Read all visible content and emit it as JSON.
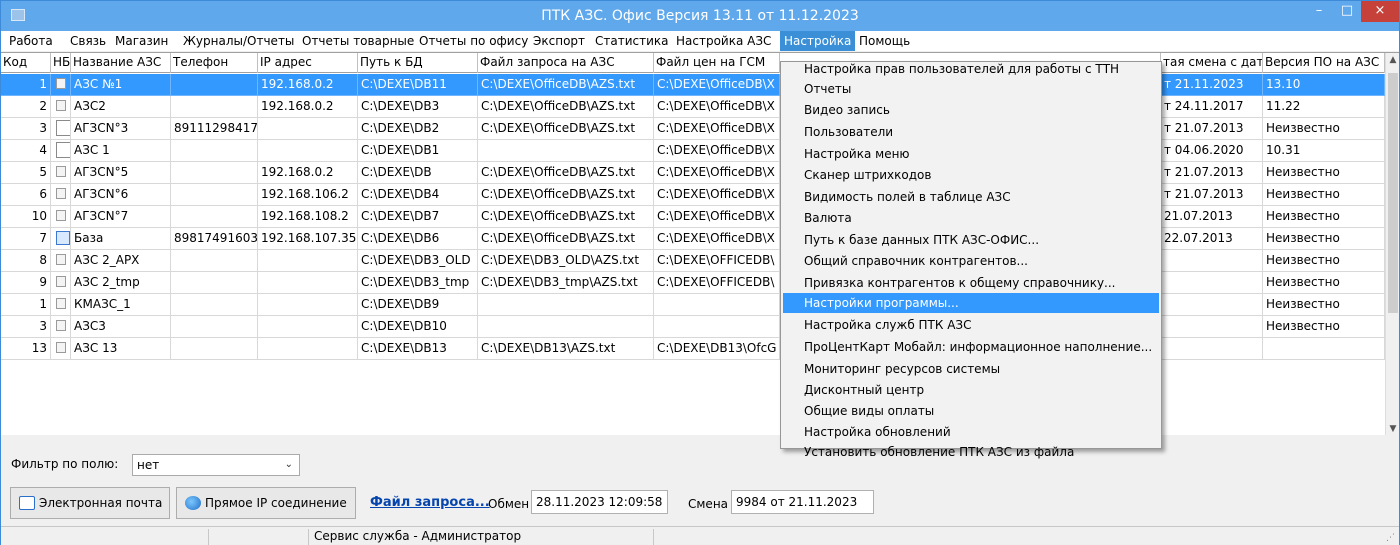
{
  "window": {
    "title": "ПТК АЗС. Офис   Версия 13.11 от 11.12.2023",
    "minimize_glyph": "–",
    "maximize_glyph": "□",
    "close_glyph": "×"
  },
  "menu": {
    "items": [
      "Работа",
      "Связь",
      "Магазин",
      "Журналы/Отчеты",
      "Отчеты товарные",
      "Отчеты по офису",
      "Экспорт",
      "Статистика",
      "Настройка АЗС",
      "Настройка",
      "Помощь"
    ],
    "active_index": 9
  },
  "table": {
    "columns": [
      "Код",
      "НБ",
      "Название АЗС",
      "Телефон",
      "IP адрес",
      "Путь к БД",
      "Файл запроса на АЗС",
      "Файл цен на ГСМ",
      "",
      "тая смена с дат",
      "Версия ПО на АЗС"
    ],
    "rows": [
      {
        "code": "1",
        "nb": "icon",
        "name": "АЗС №1",
        "phone": "",
        "ip": "192.168.0.2",
        "db": "C:\\DEXE\\DB11",
        "req": "C:\\DEXE\\OfficeDB\\AZS.txt",
        "prices": "C:\\DEXE\\OfficeDB\\X",
        "shift": "т 21.11.2023",
        "ver": "13.10",
        "selected": true
      },
      {
        "code": "2",
        "nb": "icon",
        "name": "АЗС2",
        "phone": "",
        "ip": "192.168.0.2",
        "db": "C:\\DEXE\\DB3",
        "req": "C:\\DEXE\\OfficeDB\\AZS.txt",
        "prices": "C:\\DEXE\\OfficeDB\\X",
        "shift": "т 24.11.2017",
        "ver": "11.22"
      },
      {
        "code": "3",
        "nb": "box",
        "name": "АГЗСN°3",
        "phone": "89111298417",
        "ip": "",
        "db": "C:\\DEXE\\DB2",
        "req": "C:\\DEXE\\OfficeDB\\AZS.txt",
        "prices": "C:\\DEXE\\OfficeDB\\X",
        "shift": "т 21.07.2013",
        "ver": "Неизвестно"
      },
      {
        "code": "4",
        "nb": "box",
        "name": "АЗС 1",
        "phone": "",
        "ip": "",
        "db": "C:\\DEXE\\DB1",
        "req": "",
        "prices": "C:\\DEXE\\OfficeDB\\X",
        "shift": "т 04.06.2020",
        "ver": "10.31"
      },
      {
        "code": "5",
        "nb": "icon",
        "name": "АГЗСN°5",
        "phone": "",
        "ip": "192.168.0.2",
        "db": "C:\\DEXE\\DB",
        "req": "C:\\DEXE\\OfficeDB\\AZS.txt",
        "prices": "C:\\DEXE\\OfficeDB\\X",
        "shift": "т 21.07.2013",
        "ver": "Неизвестно"
      },
      {
        "code": "6",
        "nb": "icon",
        "name": "АГЗСN°6",
        "phone": "",
        "ip": "192.168.106.2",
        "db": "C:\\DEXE\\DB4",
        "req": "C:\\DEXE\\OfficeDB\\AZS.txt",
        "prices": "C:\\DEXE\\OfficeDB\\X",
        "shift": "т 21.07.2013",
        "ver": "Неизвестно"
      },
      {
        "code": "10",
        "nb": "icon",
        "name": "АГЗСN°7",
        "phone": "",
        "ip": "192.168.108.2",
        "db": "C:\\DEXE\\DB7",
        "req": "C:\\DEXE\\OfficeDB\\AZS.txt",
        "prices": "C:\\DEXE\\OfficeDB\\X",
        "shift": "21.07.2013",
        "ver": "Неизвестно"
      },
      {
        "code": "7",
        "nb": "db",
        "name": "База",
        "phone": "89817491603",
        "ip": "192.168.107.35",
        "db": "C:\\DEXE\\DB6",
        "req": "C:\\DEXE\\OfficeDB\\AZS.txt",
        "prices": "C:\\DEXE\\OfficeDB\\X",
        "shift": "22.07.2013",
        "ver": "Неизвестно"
      },
      {
        "code": "8",
        "nb": "icon",
        "name": "АЗС 2_АРХ",
        "phone": "",
        "ip": "",
        "db": "C:\\DEXE\\DB3_OLD",
        "req": "C:\\DEXE\\DB3_OLD\\AZS.txt",
        "prices": "C:\\DEXE\\OFFICEDB\\",
        "shift": "",
        "ver": "Неизвестно"
      },
      {
        "code": "9",
        "nb": "icon",
        "name": "АЗС 2_tmp",
        "phone": "",
        "ip": "",
        "db": "C:\\DEXE\\DB3_tmp",
        "req": "C:\\DEXE\\DB3_tmp\\AZS.txt",
        "prices": "C:\\DEXE\\OFFICEDB\\",
        "shift": "",
        "ver": "Неизвестно"
      },
      {
        "code": "1",
        "nb": "icon",
        "name": "КМАЗС_1",
        "phone": "",
        "ip": "",
        "db": "C:\\DEXE\\DB9",
        "req": "",
        "prices": "",
        "shift": "",
        "ver": "Неизвестно"
      },
      {
        "code": "3",
        "nb": "icon",
        "name": "АЗС3",
        "phone": "",
        "ip": "",
        "db": "C:\\DEXE\\DB10",
        "req": "",
        "prices": "",
        "shift": "",
        "ver": "Неизвестно"
      },
      {
        "code": "13",
        "nb": "icon",
        "name": "АЗС 13",
        "phone": "",
        "ip": "",
        "db": "C:\\DEXE\\DB13",
        "req": "C:\\DEXE\\DB13\\AZS.txt",
        "prices": "C:\\DEXE\\DB13\\OfcG",
        "shift": "",
        "ver": ""
      }
    ]
  },
  "dropdown_menu": {
    "items": [
      "Настройка прав пользователей для работы с ТТН",
      "Отчеты",
      "Видео запись",
      "Пользователи",
      "Настройка меню",
      "Сканер штрихкодов",
      "Видимость полей в таблице АЗС",
      "Валюта",
      "Путь к базе данных ПТК АЗС-ОФИС...",
      "Общий справочник контрагентов...",
      "Привязка контрагентов к общему справочнику...",
      "Настройки программы...",
      "Настройка служб ПТК АЗС",
      "ПроЦентКарт Мобайл: информационное наполнение...",
      "Мониторинг ресурсов системы",
      "Дисконтный центр",
      "Общие виды оплаты",
      "Настройка обновлений",
      "Установить обновление ПТК АЗС из файла"
    ],
    "highlighted_index": 11
  },
  "filter": {
    "label": "Фильтр по полю:",
    "value": "нет"
  },
  "toolbar": {
    "email_label": "Электронная почта",
    "ip_label": "Прямое IP соединение",
    "request_link": "Файл запроса...",
    "exchange_label": "Обмен",
    "exchange_value": "28.11.2023 12:09:58",
    "shift_label": "Смена",
    "shift_value": "9984 от 21.11.2023"
  },
  "status": {
    "text": "Сервис служба - Администратор"
  },
  "colors": {
    "titlebar": "#5fa8ec",
    "selection": "#3399ff",
    "close": "#c7413b",
    "link": "#0645ad"
  }
}
